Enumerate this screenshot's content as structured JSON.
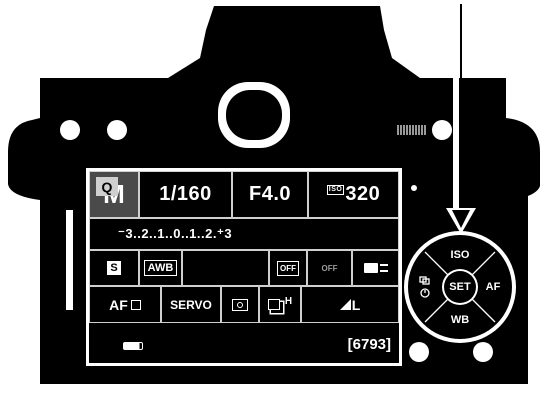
{
  "lcd": {
    "mode": "M",
    "shutter_speed": "1/160",
    "aperture": "F4.0",
    "iso_icon_label": "ISO",
    "iso_value": "320",
    "exposure_scale": "⁻3..2..1..0..1..2.⁺3",
    "picture_style": "S",
    "white_balance": "AWB",
    "flash_label": "OFF",
    "wifi_label": "OFF",
    "af_label": "AF",
    "af_mode": "SERVO",
    "drive_label": "H",
    "image_quality": "L",
    "quick_label": "Q",
    "shots_remaining": "[6793]"
  },
  "dpad": {
    "up": "ISO",
    "center": "SET",
    "right": "AF",
    "down": "WB"
  }
}
